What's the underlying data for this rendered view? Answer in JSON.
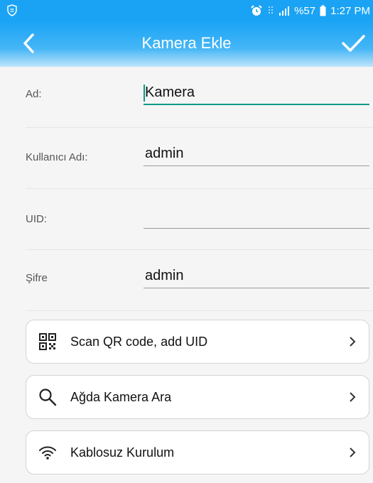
{
  "status_bar": {
    "battery_percent": "%57",
    "time": "1:27 PM"
  },
  "header": {
    "title": "Kamera Ekle"
  },
  "form": {
    "name": {
      "label": "Ad:",
      "value": "Kamera"
    },
    "username": {
      "label": "Kullanıcı Adı:",
      "value": "admin"
    },
    "uid": {
      "label": "UID:",
      "value": ""
    },
    "password": {
      "label": "Şifre",
      "value": "admin"
    }
  },
  "actions": {
    "scan_qr": {
      "label": "Scan QR code, add UID",
      "icon": "qr-code-icon"
    },
    "search_lan": {
      "label": "Ağda Kamera Ara",
      "icon": "search-icon"
    },
    "wifi_setup": {
      "label": "Kablosuz Kurulum",
      "icon": "wifi-icon"
    }
  },
  "colors": {
    "accent": "#1aa3f5",
    "focus_underline": "#0d9a86"
  }
}
